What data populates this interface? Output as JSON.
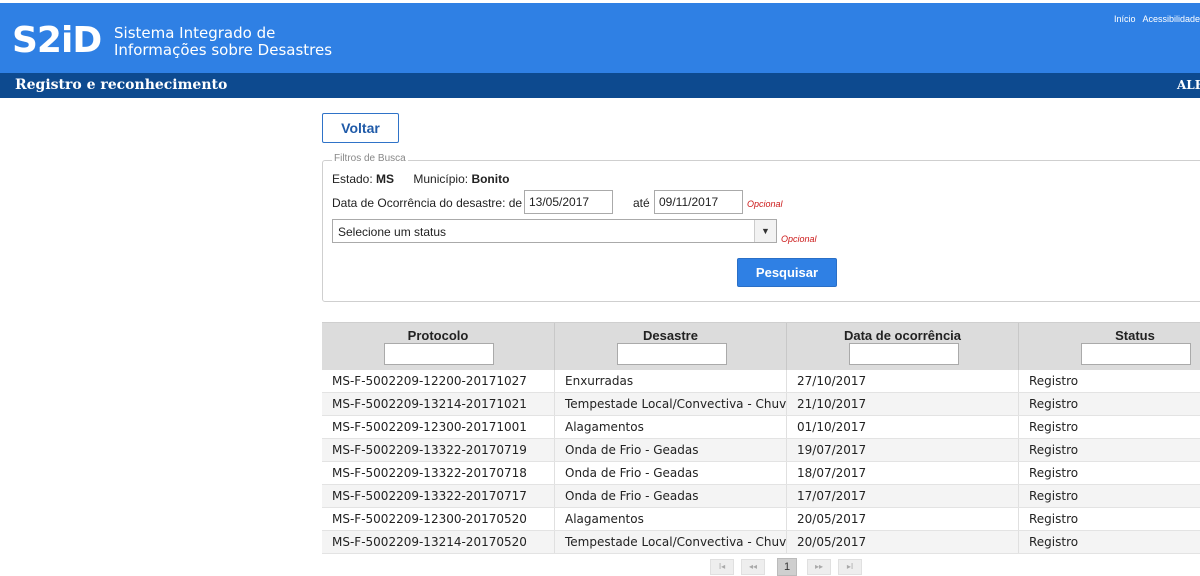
{
  "header": {
    "logo": "S2iD",
    "subtitle_line1": "Sistema Integrado de",
    "subtitle_line2": "Informações sobre Desastres",
    "links": [
      "Início",
      "Acessibilidade"
    ]
  },
  "subheader": {
    "title": "Registro e reconhecimento",
    "user": "ALEX"
  },
  "buttons": {
    "voltar": "Voltar",
    "pesquisar": "Pesquisar"
  },
  "filters": {
    "legend": "Filtros de Busca",
    "estado_label": "Estado:",
    "estado_value": "MS",
    "municipio_label": "Município:",
    "municipio_value": "Bonito",
    "date_label": "Data de Ocorrência do desastre: de",
    "date_from": "13/05/2017",
    "ate_label": "até",
    "date_to": "09/11/2017",
    "opcional": "Opcional",
    "status_select": "Selecione um status"
  },
  "table": {
    "columns": [
      "Protocolo",
      "Desastre",
      "Data de ocorrência",
      "Status"
    ],
    "rows": [
      [
        "MS-F-5002209-12200-20171027",
        "Enxurradas",
        "27/10/2017",
        "Registro"
      ],
      [
        "MS-F-5002209-13214-20171021",
        "Tempestade Local/Convectiva - Chuvas Intensas",
        "21/10/2017",
        "Registro"
      ],
      [
        "MS-F-5002209-12300-20171001",
        "Alagamentos",
        "01/10/2017",
        "Registro"
      ],
      [
        "MS-F-5002209-13322-20170719",
        "Onda de Frio - Geadas",
        "19/07/2017",
        "Registro"
      ],
      [
        "MS-F-5002209-13322-20170718",
        "Onda de Frio - Geadas",
        "18/07/2017",
        "Registro"
      ],
      [
        "MS-F-5002209-13322-20170717",
        "Onda de Frio - Geadas",
        "17/07/2017",
        "Registro"
      ],
      [
        "MS-F-5002209-12300-20170520",
        "Alagamentos",
        "20/05/2017",
        "Registro"
      ],
      [
        "MS-F-5002209-13214-20170520",
        "Tempestade Local/Convectiva - Chuvas Intensas",
        "20/05/2017",
        "Registro"
      ]
    ]
  },
  "pager": {
    "first": "I◂",
    "prev": "◂◂",
    "current": "1",
    "next": "▸▸",
    "last": "▸I"
  }
}
